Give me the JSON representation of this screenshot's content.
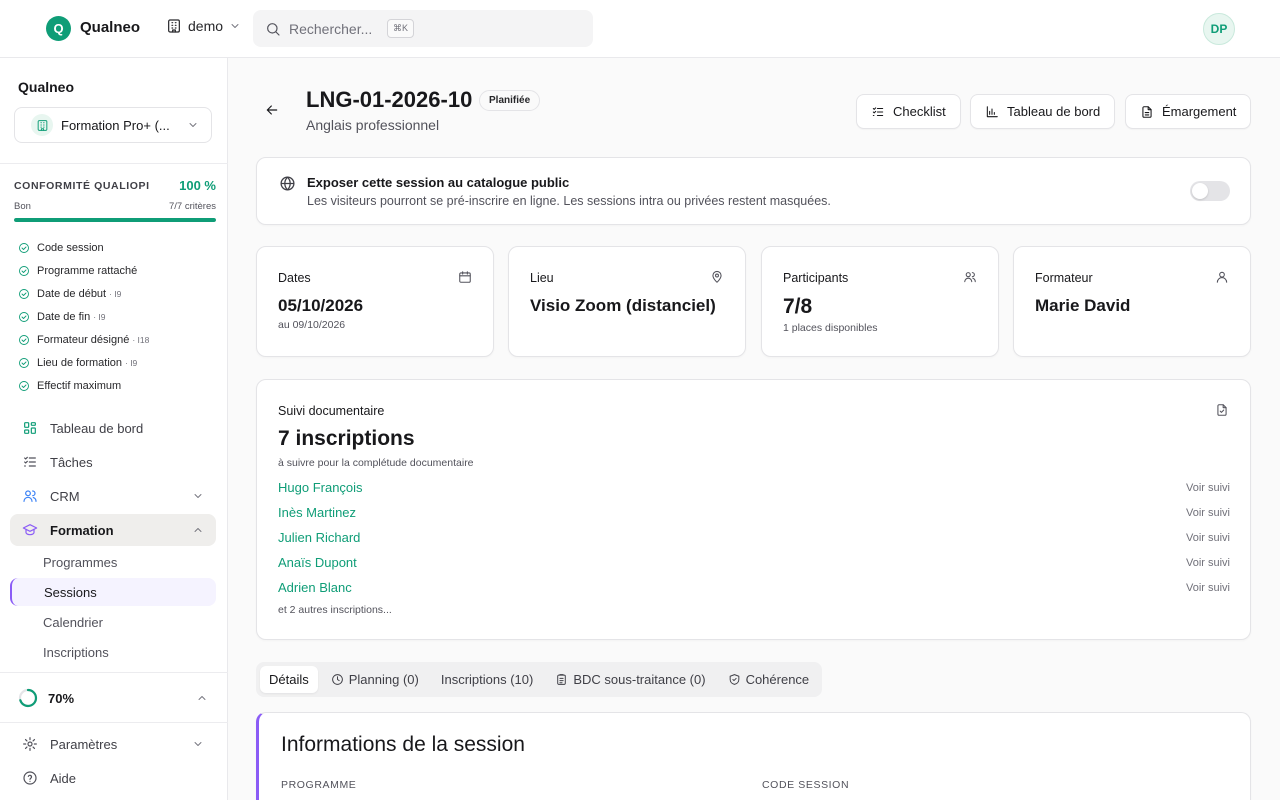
{
  "topbar": {
    "logo_letter": "Q",
    "brand": "Qualneo",
    "org": "demo",
    "search_placeholder": "Rechercher...",
    "search_shortcut": "⌘K",
    "user_initials": "DP"
  },
  "sidebar": {
    "title": "Qualneo",
    "org_select": "Formation Pro+ (...",
    "qualiopi": {
      "title": "CONFORMITÉ QUALIOPI",
      "percent": "100 %",
      "level": "Bon",
      "criteria": "7/7 critères",
      "progress": 1.0,
      "checks": [
        {
          "label": "Code session",
          "ref": ""
        },
        {
          "label": "Programme rattaché",
          "ref": ""
        },
        {
          "label": "Date de début",
          "ref": "· I9"
        },
        {
          "label": "Date de fin",
          "ref": "· I9"
        },
        {
          "label": "Formateur désigné",
          "ref": "· I18"
        },
        {
          "label": "Lieu de formation",
          "ref": "· I9"
        },
        {
          "label": "Effectif maximum",
          "ref": ""
        }
      ]
    },
    "nav": {
      "dashboard": "Tableau de bord",
      "tasks": "Tâches",
      "crm": "CRM",
      "formation": "Formation",
      "settings": "Paramètres",
      "help": "Aide"
    },
    "subnav": {
      "programmes": "Programmes",
      "sessions": "Sessions",
      "calendar": "Calendrier",
      "inscriptions": "Inscriptions"
    },
    "progress_label": "70%",
    "progress_value": 0.7
  },
  "header": {
    "title": "LNG-01-2026-10",
    "badge": "Planifiée",
    "subtitle": "Anglais professionnel",
    "buttons": {
      "checklist": "Checklist",
      "dashboard": "Tableau de bord",
      "emargement": "Émargement"
    }
  },
  "expose": {
    "title": "Exposer cette session au catalogue public",
    "description": "Les visiteurs pourront se pré-inscrire en ligne. Les sessions intra ou privées restent masquées."
  },
  "stats": {
    "dates": {
      "label": "Dates",
      "value": "05/10/2026",
      "sub": "au 09/10/2026"
    },
    "lieu": {
      "label": "Lieu",
      "value": "Visio Zoom (distanciel)"
    },
    "participants": {
      "label": "Participants",
      "value": "7/8",
      "sub": "1 places disponibles"
    },
    "formateur": {
      "label": "Formateur",
      "value": "Marie David"
    }
  },
  "suivi": {
    "label": "Suivi documentaire",
    "count": "7 inscriptions",
    "hint": "à suivre pour la complétude documentaire",
    "action_label": "Voir suivi",
    "people": [
      "Hugo François",
      "Inès Martinez",
      "Julien Richard",
      "Anaïs Dupont",
      "Adrien Blanc"
    ],
    "more": "et 2 autres inscriptions..."
  },
  "tabs": [
    "Détails",
    "Planning (0)",
    "Inscriptions (10)",
    "BDC sous-traitance (0)",
    "Cohérence"
  ],
  "info": {
    "title": "Informations de la session",
    "field_programme": "PROGRAMME",
    "field_code": "CODE SESSION"
  },
  "colors": {
    "accent": "#0f9d77",
    "purple": "#8b5cf6"
  }
}
